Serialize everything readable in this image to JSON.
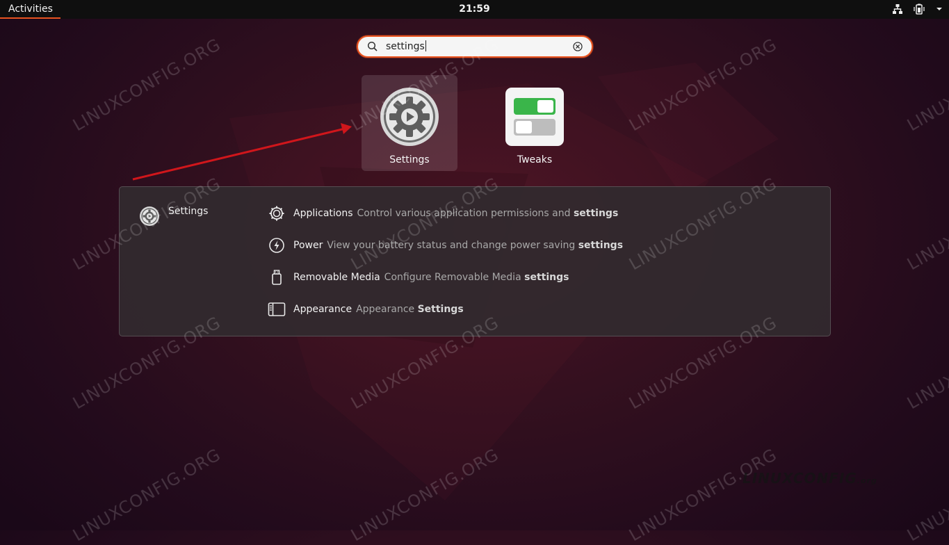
{
  "topbar": {
    "activities_label": "Activities",
    "clock": "21:59",
    "tray_icons": [
      "network-icon",
      "battery-icon",
      "system-menu-chevron-icon"
    ]
  },
  "search": {
    "value": "settings",
    "left_icon": "search-icon",
    "right_icon": "clear-icon"
  },
  "apps": [
    {
      "label": "Settings",
      "icon": "settings-gear-icon",
      "selected": true
    },
    {
      "label": "Tweaks",
      "icon": "tweaks-toggle-icon",
      "selected": false
    }
  ],
  "results_panel": {
    "provider": {
      "name": "Settings",
      "icon": "settings-gear-icon"
    },
    "results": [
      {
        "name": "Applications",
        "desc_prefix": "Control various application permissions and",
        "desc_bold": "settings",
        "icon": "applications-icon"
      },
      {
        "name": "Power",
        "desc_prefix": "View your battery status and change power saving",
        "desc_bold": "settings",
        "icon": "power-icon"
      },
      {
        "name": "Removable Media",
        "desc_prefix": "Configure Removable Media",
        "desc_bold": "settings",
        "icon": "removable-media-icon"
      },
      {
        "name": "Appearance",
        "desc_prefix": "Appearance",
        "desc_bold": "Settings",
        "icon": "appearance-icon"
      }
    ]
  },
  "watermark": {
    "text": "LINUXCONFIG.ORG",
    "logo_main": "LINUXCONFIG",
    "logo_suffix": ".org"
  },
  "colors": {
    "accent": "#e95420",
    "annotation_arrow": "#d0161b",
    "topbar_bg": "#0f0f0f"
  }
}
